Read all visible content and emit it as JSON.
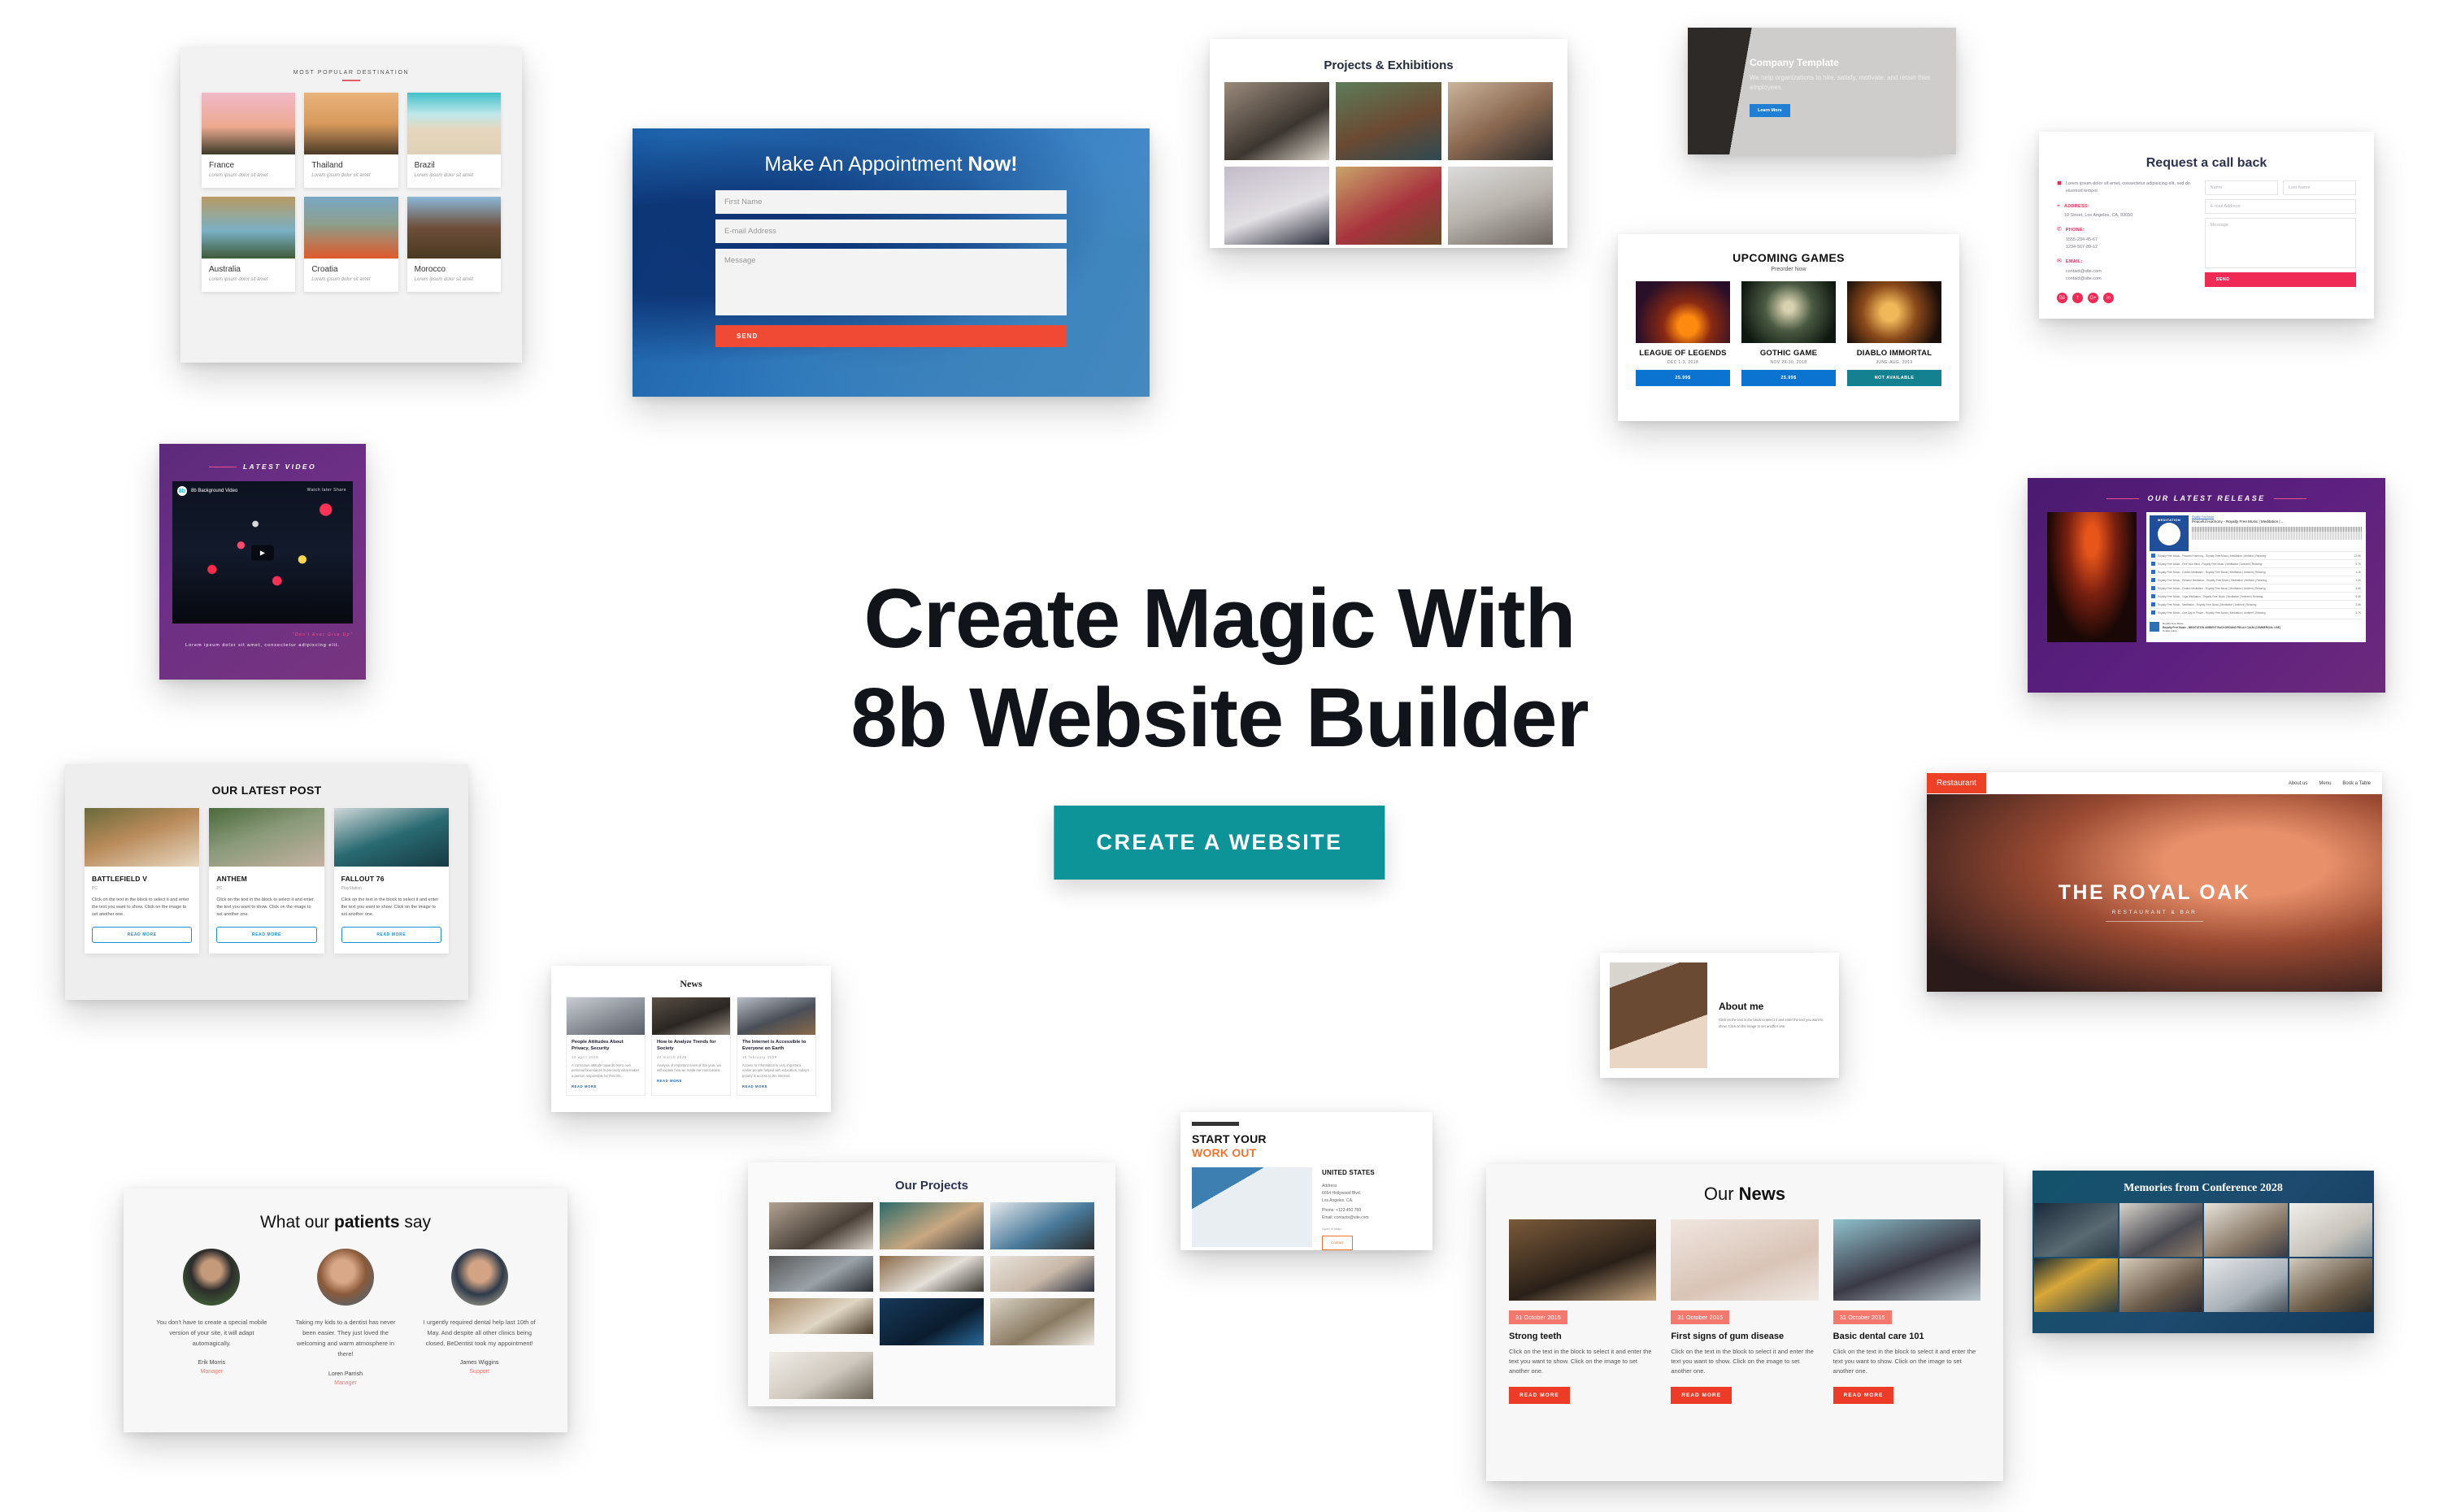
{
  "hero": {
    "line1": "Create Magic With",
    "line2": "8b Website Builder",
    "cta_label": "CREATE A WEBSITE",
    "cta_color": "#0d9499"
  },
  "destinations": {
    "eyebrow": "MOST POPULAR DESTINATION",
    "items": [
      {
        "title": "France",
        "subtitle": "Lorem ipsum dolor sit amet"
      },
      {
        "title": "Thailand",
        "subtitle": "Lorem ipsum dolor sit amet"
      },
      {
        "title": "Brazil",
        "subtitle": "Lorem ipsum dolor sit amet"
      },
      {
        "title": "Australia",
        "subtitle": "Lorem ipsum dolor sit amet"
      },
      {
        "title": "Croatia",
        "subtitle": "Lorem ipsum dolor sit amet"
      },
      {
        "title": "Morocco",
        "subtitle": "Lorem ipsum dolor sit amet"
      }
    ]
  },
  "appointment": {
    "title_regular": "Make An Appointment ",
    "title_bold": "Now!",
    "first_name_placeholder": "First Name",
    "email_placeholder": "E-mail Address",
    "message_placeholder": "Message",
    "send_label": "SEND",
    "send_color": "#f04a35"
  },
  "exhibitions": {
    "title": "Projects & Exhibitions"
  },
  "company": {
    "title": "Company Template",
    "body": "We help organizations to hire, satisfy, motivate, and retain thier employees.",
    "button_label": "Learn More"
  },
  "callback": {
    "title": "Request a call back",
    "intro": "Lorem ipsum dolor sit amet, consectetur adipisicing elit, sed do eiusmod tempor.",
    "address_label": "ADDRESS:",
    "address_value": "10 Street, Los Angeles, CA, 93050",
    "phone_label": "PHONE:",
    "phone_1": "1555-234-45-67",
    "phone_2": "1234-567-89-12",
    "email_label": "EMAIL:",
    "email_1": "contact@site.com",
    "email_2": "contact@site.com",
    "social": [
      "behance-icon",
      "facebook-icon",
      "google-plus-icon",
      "linkedin-icon"
    ],
    "name_placeholder": "Name",
    "lastname_placeholder": "Last Name",
    "email_placeholder": "E-mail Address",
    "message_placeholder": "Message",
    "send_label": "SEND",
    "accent_color": "#ee2a55"
  },
  "games": {
    "title": "UPCOMING GAMES",
    "subtitle": "Preorder Now",
    "items": [
      {
        "name": "LEAGUE OF LEGENDS",
        "date": "DEC 1-3, 2018",
        "button": "25.99$",
        "style": "blue"
      },
      {
        "name": "GOTHIC GAME",
        "date": "NOV 29-30, 2018",
        "button": "25.99$",
        "style": "blue"
      },
      {
        "name": "DIABLO IMMORTAL",
        "date": "JUNE-AUG, 2019",
        "button": "NOT AVAILABLE",
        "style": "teal"
      }
    ]
  },
  "video": {
    "title": "LATEST VIDEO",
    "player_name": "8b Background Video",
    "player_logo": "8b",
    "controls": "Watch later   Share",
    "quote": "\"Don't Ever Give Up\"",
    "description": "Lorem ipsum dolor sit amet, consectetur adipiscing elit."
  },
  "latest_post": {
    "title": "OUR LATEST POST",
    "items": [
      {
        "title": "BATTLEFIELD V",
        "platform": "PC",
        "text": "Click on the text in the block to select it and enter the text you want to show. Click on the image to set another one.",
        "button": "READ MORE"
      },
      {
        "title": "ANTHEM",
        "platform": "PC",
        "text": "Click on the text in the block to select it and enter the text you want to show. Click on the image to set another one.",
        "button": "READ MORE"
      },
      {
        "title": "FALLOUT 76",
        "platform": "PlayStation",
        "text": "Click on the text in the block to select it and enter the text you want to show. Click on the image to set another one.",
        "button": "READ MORE"
      }
    ]
  },
  "news": {
    "title": "News",
    "items": [
      {
        "title": "People Attitudes About Privacy, Security",
        "date": "10 april 2028",
        "text": "A conscious attitude towards one's own personal boundaries is precisely what makes a person responsible for their life.",
        "link": "READ MORE"
      },
      {
        "title": "How to Analyze Trends for Society",
        "date": "23 march 2028",
        "text": "Analysis of important news of this year, we will explain how we made our conclusions.",
        "link": "READ MORE"
      },
      {
        "title": "The Internet is Accessible to Everyone on Earth",
        "date": "15 february 2028",
        "text": "Access to information is very important, earlier people helped with education, today's priority is access to the Internet.",
        "link": "READ MORE"
      }
    ]
  },
  "workout": {
    "line1": "START YOUR",
    "line2": "WORK OUT",
    "country": "UNITED STATES",
    "address_label": "Address",
    "address_1": "6654 Hollywood Blvd.",
    "address_2": "Los Angeles, CA.",
    "phone": "Phone: +123 450 789",
    "email": "Email: contacts@site.com",
    "map_link": "Open in Map  ›",
    "button": "Contact"
  },
  "about_me": {
    "title": "About me",
    "text": "Click on the text in the block to select it and enter the text you want to show. Click on the image to set another one."
  },
  "our_news": {
    "title_regular": "Our ",
    "title_bold": "News",
    "items": [
      {
        "date": "31 October 2015",
        "title": "Strong teeth",
        "text": "Click on the text in the block to select it and enter the text you want to show. Click on the image to set another one.",
        "button": "READ MORE"
      },
      {
        "date": "31 October 2015",
        "title": "First signs of gum disease",
        "text": "Click on the text in the block to select it and enter the text you want to show. Click on the image to set another one.",
        "button": "READ MORE"
      },
      {
        "date": "31 October 2015",
        "title": "Basic dental care 101",
        "text": "Click on the text in the block to select it and enter the text you want to show. Click on the image to set another one.",
        "button": "READ MORE"
      }
    ],
    "badge_color": "#f5786e",
    "button_color": "#ec3b26"
  },
  "patients": {
    "title_a": "What our ",
    "title_b": "patients",
    "title_c": " say",
    "items": [
      {
        "quote": "You don't have to create a special mobile version of your site, it will adapt automagically.",
        "name": "Erik Morris",
        "role": "Manager"
      },
      {
        "quote": "Taking my kids to a dentist has never been easier. They just loved the welcoming and warm atmosphere in there!",
        "name": "Loren Parrish",
        "role": "Manager"
      },
      {
        "quote": "I urgently required dental help last 10th of May. And despite all other clinics being closed, BeDentist took my appointment!",
        "name": "James Wiggins",
        "role": "Support"
      }
    ]
  },
  "projects": {
    "title": "Our Projects"
  },
  "royal_oak": {
    "brand": "Restaurant",
    "nav": [
      "About us",
      "Menu",
      "Book a Table"
    ],
    "title": "THE ROYAL OAK",
    "subtitle": "RESTAURANT  &  BAR"
  },
  "release": {
    "title": "OUR LATEST RELEASE",
    "artwork_label": "MEDITATION",
    "player_artist": "Royalty Free Music",
    "player_track": "Peaceful Harmony - Royalty Free Music | Meditation | ...",
    "platform": "SOUNDCLOUD",
    "share_label": "Share",
    "duration": "0:31",
    "plays_top": "12.4K",
    "tracks": [
      {
        "name": "Royalty Free Music - Peaceful Harmony - Royalty Free Music | Meditation | Ambient | Relaxing",
        "plays": "12.4K"
      },
      {
        "name": "Royalty Free Music - Free Your Mind - Royalty Free Music | Meditation | Ambient | Relaxing",
        "plays": "9.7K"
      },
      {
        "name": "Royalty Free Music - Guided Meditation - Royalty Free Music | Meditation | Ambient | Relaxing",
        "plays": "4.1K"
      },
      {
        "name": "Royalty Free Music - Relaxed Meditation - Royalty Free Music | Meditation | Ambient | Relaxing",
        "plays": "3.2K"
      },
      {
        "name": "Royalty Free Music - Chakra Meditation - Royalty Free Music | Meditation | Ambient | Relaxing",
        "plays": "3.8K"
      },
      {
        "name": "Royalty Free Music - Yoga Meditation - Royalty Free Music | Meditation | Ambient | Relaxing",
        "plays": "5.4K"
      },
      {
        "name": "Royalty Free Music - Meditation - Royalty Free Music | Meditation | Ambient | Relaxing",
        "plays": "2.5K"
      },
      {
        "name": "Royalty Free Music - One Day In Peace - Royalty Free Music | Meditation | Ambient | Relaxing",
        "plays": "2.7K"
      }
    ],
    "footer_artist": "Royalty Free Music",
    "footer_title": "Royalty Free Music - MEDITATION AMBIENT BACKGROUND RELAX CALM (COMMERCIAL USE)",
    "footer_note": "Cookie policy"
  },
  "conference": {
    "title": "Memories from Conference 2028"
  }
}
